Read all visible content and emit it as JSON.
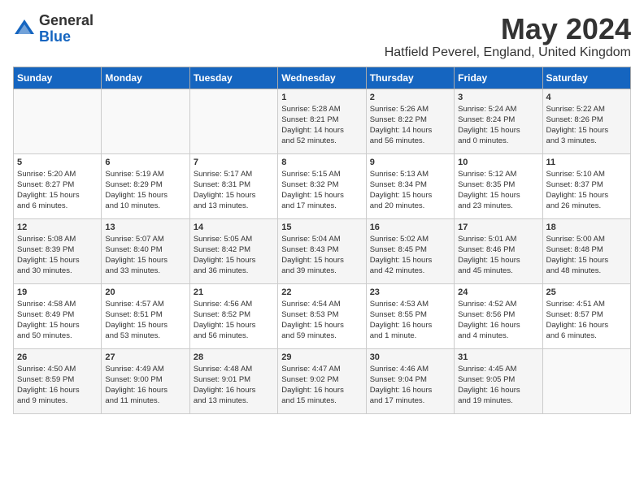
{
  "header": {
    "logo_general": "General",
    "logo_blue": "Blue",
    "month_title": "May 2024",
    "location": "Hatfield Peverel, England, United Kingdom"
  },
  "calendar": {
    "weekdays": [
      "Sunday",
      "Monday",
      "Tuesday",
      "Wednesday",
      "Thursday",
      "Friday",
      "Saturday"
    ],
    "rows": [
      [
        {
          "day": "",
          "text": ""
        },
        {
          "day": "",
          "text": ""
        },
        {
          "day": "",
          "text": ""
        },
        {
          "day": "1",
          "text": "Sunrise: 5:28 AM\nSunset: 8:21 PM\nDaylight: 14 hours\nand 52 minutes."
        },
        {
          "day": "2",
          "text": "Sunrise: 5:26 AM\nSunset: 8:22 PM\nDaylight: 14 hours\nand 56 minutes."
        },
        {
          "day": "3",
          "text": "Sunrise: 5:24 AM\nSunset: 8:24 PM\nDaylight: 15 hours\nand 0 minutes."
        },
        {
          "day": "4",
          "text": "Sunrise: 5:22 AM\nSunset: 8:26 PM\nDaylight: 15 hours\nand 3 minutes."
        }
      ],
      [
        {
          "day": "5",
          "text": "Sunrise: 5:20 AM\nSunset: 8:27 PM\nDaylight: 15 hours\nand 6 minutes."
        },
        {
          "day": "6",
          "text": "Sunrise: 5:19 AM\nSunset: 8:29 PM\nDaylight: 15 hours\nand 10 minutes."
        },
        {
          "day": "7",
          "text": "Sunrise: 5:17 AM\nSunset: 8:31 PM\nDaylight: 15 hours\nand 13 minutes."
        },
        {
          "day": "8",
          "text": "Sunrise: 5:15 AM\nSunset: 8:32 PM\nDaylight: 15 hours\nand 17 minutes."
        },
        {
          "day": "9",
          "text": "Sunrise: 5:13 AM\nSunset: 8:34 PM\nDaylight: 15 hours\nand 20 minutes."
        },
        {
          "day": "10",
          "text": "Sunrise: 5:12 AM\nSunset: 8:35 PM\nDaylight: 15 hours\nand 23 minutes."
        },
        {
          "day": "11",
          "text": "Sunrise: 5:10 AM\nSunset: 8:37 PM\nDaylight: 15 hours\nand 26 minutes."
        }
      ],
      [
        {
          "day": "12",
          "text": "Sunrise: 5:08 AM\nSunset: 8:39 PM\nDaylight: 15 hours\nand 30 minutes."
        },
        {
          "day": "13",
          "text": "Sunrise: 5:07 AM\nSunset: 8:40 PM\nDaylight: 15 hours\nand 33 minutes."
        },
        {
          "day": "14",
          "text": "Sunrise: 5:05 AM\nSunset: 8:42 PM\nDaylight: 15 hours\nand 36 minutes."
        },
        {
          "day": "15",
          "text": "Sunrise: 5:04 AM\nSunset: 8:43 PM\nDaylight: 15 hours\nand 39 minutes."
        },
        {
          "day": "16",
          "text": "Sunrise: 5:02 AM\nSunset: 8:45 PM\nDaylight: 15 hours\nand 42 minutes."
        },
        {
          "day": "17",
          "text": "Sunrise: 5:01 AM\nSunset: 8:46 PM\nDaylight: 15 hours\nand 45 minutes."
        },
        {
          "day": "18",
          "text": "Sunrise: 5:00 AM\nSunset: 8:48 PM\nDaylight: 15 hours\nand 48 minutes."
        }
      ],
      [
        {
          "day": "19",
          "text": "Sunrise: 4:58 AM\nSunset: 8:49 PM\nDaylight: 15 hours\nand 50 minutes."
        },
        {
          "day": "20",
          "text": "Sunrise: 4:57 AM\nSunset: 8:51 PM\nDaylight: 15 hours\nand 53 minutes."
        },
        {
          "day": "21",
          "text": "Sunrise: 4:56 AM\nSunset: 8:52 PM\nDaylight: 15 hours\nand 56 minutes."
        },
        {
          "day": "22",
          "text": "Sunrise: 4:54 AM\nSunset: 8:53 PM\nDaylight: 15 hours\nand 59 minutes."
        },
        {
          "day": "23",
          "text": "Sunrise: 4:53 AM\nSunset: 8:55 PM\nDaylight: 16 hours\nand 1 minute."
        },
        {
          "day": "24",
          "text": "Sunrise: 4:52 AM\nSunset: 8:56 PM\nDaylight: 16 hours\nand 4 minutes."
        },
        {
          "day": "25",
          "text": "Sunrise: 4:51 AM\nSunset: 8:57 PM\nDaylight: 16 hours\nand 6 minutes."
        }
      ],
      [
        {
          "day": "26",
          "text": "Sunrise: 4:50 AM\nSunset: 8:59 PM\nDaylight: 16 hours\nand 9 minutes."
        },
        {
          "day": "27",
          "text": "Sunrise: 4:49 AM\nSunset: 9:00 PM\nDaylight: 16 hours\nand 11 minutes."
        },
        {
          "day": "28",
          "text": "Sunrise: 4:48 AM\nSunset: 9:01 PM\nDaylight: 16 hours\nand 13 minutes."
        },
        {
          "day": "29",
          "text": "Sunrise: 4:47 AM\nSunset: 9:02 PM\nDaylight: 16 hours\nand 15 minutes."
        },
        {
          "day": "30",
          "text": "Sunrise: 4:46 AM\nSunset: 9:04 PM\nDaylight: 16 hours\nand 17 minutes."
        },
        {
          "day": "31",
          "text": "Sunrise: 4:45 AM\nSunset: 9:05 PM\nDaylight: 16 hours\nand 19 minutes."
        },
        {
          "day": "",
          "text": ""
        }
      ]
    ]
  }
}
